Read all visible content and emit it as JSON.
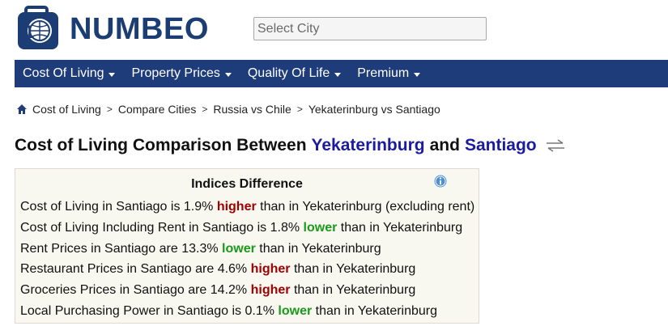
{
  "brand": {
    "name": "NUMBEO"
  },
  "search": {
    "placeholder": "Select City"
  },
  "nav": {
    "items": [
      {
        "label": "Cost Of Living"
      },
      {
        "label": "Property Prices"
      },
      {
        "label": "Quality Of Life"
      },
      {
        "label": "Premium"
      }
    ]
  },
  "breadcrumb": {
    "items": [
      "Cost of Living",
      "Compare Cities",
      "Russia vs Chile",
      "Yekaterinburg vs Santiago"
    ]
  },
  "title": {
    "prefix": "Cost of Living Comparison Between",
    "city1": "Yekaterinburg",
    "conj": "and",
    "city2": "Santiago"
  },
  "panel": {
    "heading": "Indices Difference",
    "rows": [
      {
        "pre": "Cost of Living in Santiago is 1.9%",
        "word": "higher",
        "post": "than in Yekaterinburg (excluding rent)"
      },
      {
        "pre": "Cost of Living Including Rent in Santiago is 1.8%",
        "word": "lower",
        "post": "than in Yekaterinburg"
      },
      {
        "pre": "Rent Prices in Santiago are 13.3%",
        "word": "lower",
        "post": "than in Yekaterinburg"
      },
      {
        "pre": "Restaurant Prices in Santiago are 4.6%",
        "word": "higher",
        "post": "than in Yekaterinburg"
      },
      {
        "pre": "Groceries Prices in Santiago are 14.2%",
        "word": "higher",
        "post": "than in Yekaterinburg"
      },
      {
        "pre": "Local Purchasing Power in Santiago is 0.1%",
        "word": "lower",
        "post": "than in Yekaterinburg"
      }
    ]
  },
  "colors": {
    "nav_bg": "#1f3c7a",
    "brand": "#1b3d74",
    "city": "#1b1ba0",
    "higher": "#a00000",
    "lower": "#1a9a1a"
  }
}
